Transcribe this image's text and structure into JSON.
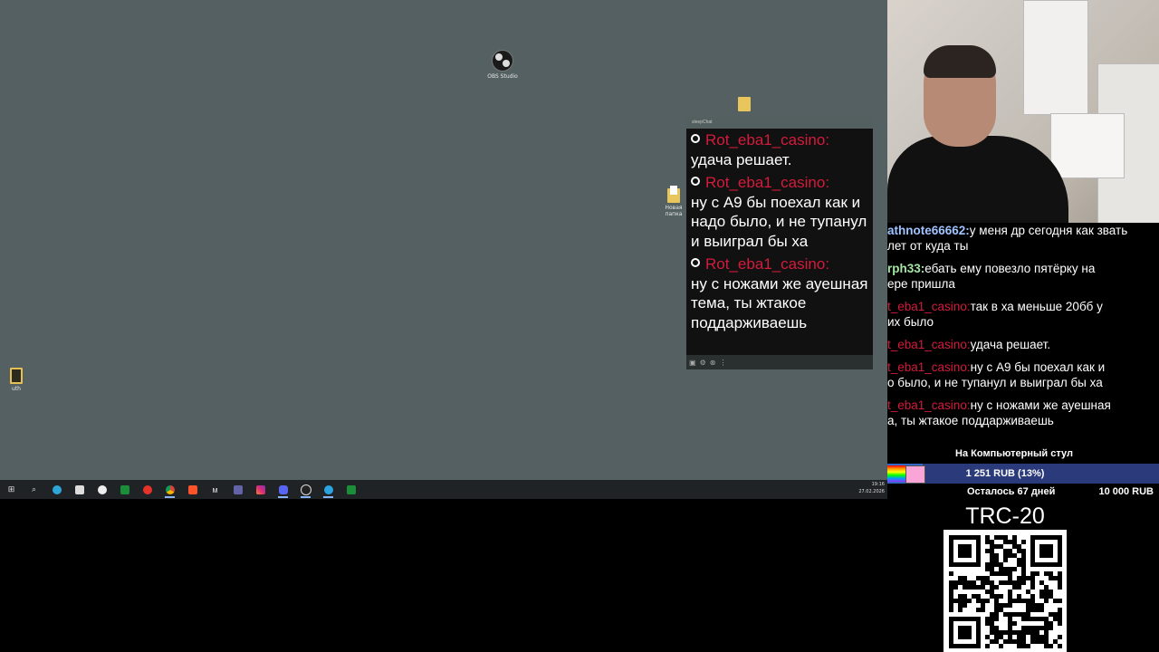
{
  "desktop": {
    "icons": [
      {
        "label": "OBS Studio"
      },
      {
        "label": ""
      },
      {
        "label": "Новая папка"
      },
      {
        "label": "uth"
      }
    ]
  },
  "taskbar": {
    "items": [
      "start",
      "search",
      "edge",
      "store",
      "yandex-browser",
      "app",
      "yandex",
      "chrome",
      "brave",
      "ms",
      "teams",
      "instagram",
      "discord",
      "chrome2",
      "telegram",
      "app2"
    ],
    "tray": {
      "time": "19:16",
      "date": "27.02.2026"
    }
  },
  "chat_popout": {
    "title": "sleepChat",
    "messages": [
      {
        "user": "Rot_eba1_casino:",
        "text": "удача решает."
      },
      {
        "user": "Rot_eba1_casino:",
        "text": "ну с A9 бы поехал как и надо было, и не тупанул и выиграл бы ха"
      },
      {
        "user": "Rot_eba1_casino:",
        "text": "ну с ножами же ауешная тема, ты жтакое поддарживаешь"
      }
    ]
  },
  "stream_chat": {
    "messages": [
      {
        "user": "athnote66662:",
        "text": "у меня др сегодня как звать",
        "cont": "лет от куда ты",
        "color": "#9fc4ff"
      },
      {
        "user": "rph33:",
        "text": "ебать ему повезло пятёрку на",
        "cont": "ере пришла",
        "color": "#a4e6a4"
      },
      {
        "user": "t_eba1_casino:",
        "text": "так в ха меньше 20бб у",
        "cont": "их было",
        "color": "#d41b3c"
      },
      {
        "user": "t_eba1_casino:",
        "text": "удача решает.",
        "cont": "",
        "color": "#d41b3c"
      },
      {
        "user": "t_eba1_casino:",
        "text": "ну с A9 бы поехал как и",
        "cont": "о было, и не тупанул и выиграл бы ха",
        "color": "#d41b3c"
      },
      {
        "user": "t_eba1_casino:",
        "text": "ну с ножами же ауешная",
        "cont": "а, ты жтакое поддарживаешь",
        "color": "#d41b3c"
      }
    ]
  },
  "donation_goal": {
    "title": "На Компьютерный стул",
    "progress_text": "1 251 RUB (13%)",
    "progress_fraction": 0.13,
    "days_left": "Осталось 67 дней",
    "target": "10 000 RUB"
  },
  "crypto": {
    "label": "TRC-20"
  }
}
